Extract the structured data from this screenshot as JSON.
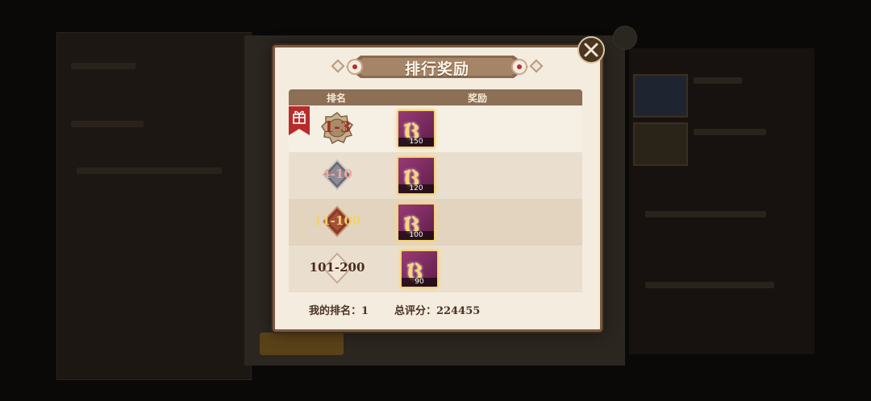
{
  "dialog": {
    "title": "排行奖励",
    "close_icon": "close-icon"
  },
  "table": {
    "header_rank": "排名",
    "header_reward": "奖励",
    "rows": [
      {
        "rank": "1-3",
        "reward_count": "150",
        "badge_color": "#b59a7a"
      },
      {
        "rank": "4-10",
        "reward_count": "120",
        "badge_color": "#8e8a90"
      },
      {
        "rank": "11-100",
        "reward_count": "100",
        "badge_color": "#9a4a34"
      },
      {
        "rank": "101-200",
        "reward_count": "90",
        "badge_color": "#e8d8c2"
      }
    ]
  },
  "footer": {
    "my_rank_label": "我的排名：",
    "my_rank_value": "1",
    "score_label": "总评分：",
    "score_value": "224455"
  },
  "icons": {
    "gift": "gift-tag-icon",
    "reward_item": "medal-icon"
  },
  "colors": {
    "accent": "#8c6f55",
    "dialog_bg": "#f4ecdf",
    "title_text": "#fdf6ea"
  }
}
